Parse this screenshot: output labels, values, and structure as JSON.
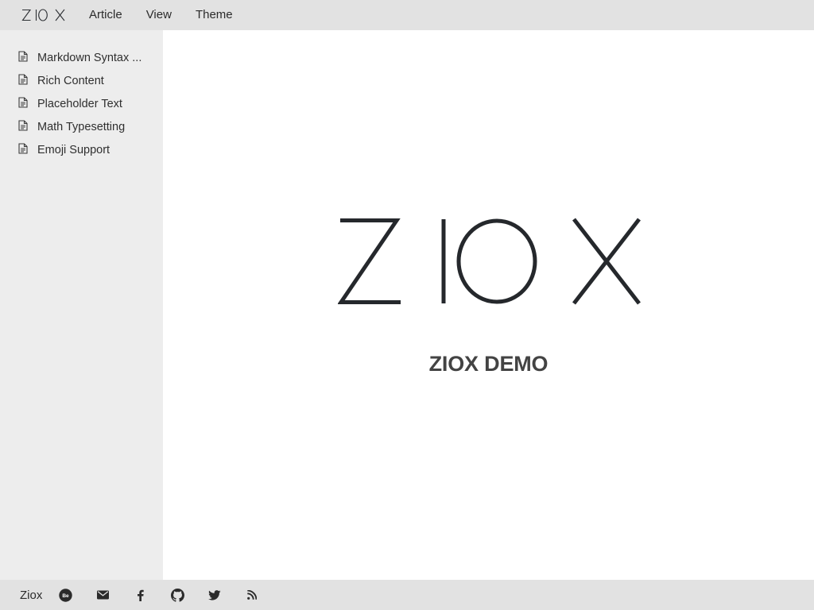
{
  "header": {
    "logo_text": "ZIOX",
    "menu": [
      {
        "label": "Article"
      },
      {
        "label": "View"
      },
      {
        "label": "Theme"
      }
    ]
  },
  "sidebar": {
    "items": [
      {
        "label": "Markdown Syntax ...",
        "icon": "document-icon"
      },
      {
        "label": "Rich Content",
        "icon": "document-icon"
      },
      {
        "label": "Placeholder Text",
        "icon": "document-icon"
      },
      {
        "label": "Math Typesetting",
        "icon": "document-icon"
      },
      {
        "label": "Emoji Support",
        "icon": "document-icon"
      }
    ]
  },
  "main": {
    "hero_logo_text": "ZIOX",
    "subtitle": "ZIOX DEMO"
  },
  "footer": {
    "brand": "Ziox",
    "social_icons": [
      "behance-icon",
      "email-icon",
      "facebook-icon",
      "github-icon",
      "twitter-icon",
      "rss-icon"
    ]
  },
  "colors": {
    "topbar_bg": "#e2e2e2",
    "sidebar_bg": "#ededed",
    "main_bg": "#ffffff",
    "text": "#2a2a2a",
    "logo": "#25282c"
  }
}
